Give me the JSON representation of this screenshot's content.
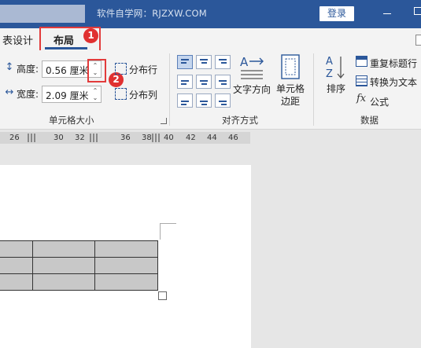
{
  "titlebar": {
    "watermark": "软件自学网：RJZXW.COM",
    "login_label": "登录"
  },
  "tabs": {
    "table_design": "表设计",
    "layout": "布局"
  },
  "annotations": {
    "badge_1": "1",
    "badge_2": "2",
    "highlight_color": "#e23b3b"
  },
  "cell_size": {
    "height_label": "高度:",
    "height_value": "0.56 厘米",
    "width_label": "宽度:",
    "width_value": "2.09 厘米",
    "distribute_rows": "分布行",
    "distribute_cols": "分布列",
    "group_label": "单元格大小"
  },
  "alignment": {
    "text_direction": "文字方向",
    "cell_margins_line1": "单元格",
    "cell_margins_line2": "边距",
    "group_label": "对齐方式"
  },
  "data_group": {
    "sort": "排序",
    "repeat_header": "重复标题行",
    "convert_to_text": "转换为文本",
    "formula": "公式",
    "formula_icon": "fx",
    "group_label": "数据"
  },
  "ruler": {
    "ticks": [
      "26",
      "30",
      "32",
      "36",
      "38",
      "40",
      "42",
      "44",
      "46"
    ]
  },
  "colors": {
    "accent": "#2b579a",
    "ribbon_bg": "#f3f3f3"
  }
}
